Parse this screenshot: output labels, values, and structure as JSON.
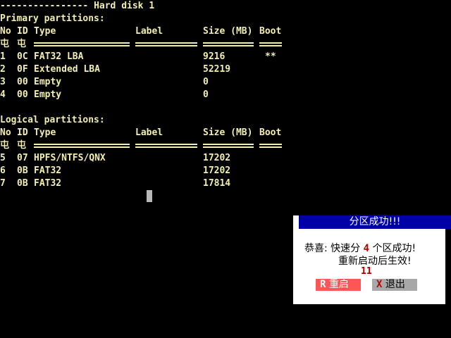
{
  "header": {
    "dashes": "----------------",
    "title": "Hard disk 1"
  },
  "columns": {
    "no": "No",
    "id": "ID",
    "type": "Type",
    "label": "Label",
    "size": "Size (MB)",
    "boot": "Boot"
  },
  "sep_glyph": "屯",
  "primary": {
    "heading": "Primary partitions:",
    "rows": [
      {
        "no": "1",
        "id": "0C",
        "type": "FAT32 LBA",
        "label": "",
        "size": "9216",
        "boot": "**"
      },
      {
        "no": "2",
        "id": "0F",
        "type": "Extended LBA",
        "label": "",
        "size": "52219",
        "boot": ""
      },
      {
        "no": "3",
        "id": "00",
        "type": "Empty",
        "label": "",
        "size": "0",
        "boot": ""
      },
      {
        "no": "4",
        "id": "00",
        "type": "Empty",
        "label": "",
        "size": "0",
        "boot": ""
      }
    ]
  },
  "logical": {
    "heading": "Logical partitions:",
    "rows": [
      {
        "no": "5",
        "id": "07",
        "type": "HPFS/NTFS/QNX",
        "label": "",
        "size": "17202",
        "boot": ""
      },
      {
        "no": "6",
        "id": "0B",
        "type": "FAT32",
        "label": "",
        "size": "17202",
        "boot": ""
      },
      {
        "no": "7",
        "id": "0B",
        "type": "FAT32",
        "label": "",
        "size": "17814",
        "boot": ""
      }
    ]
  },
  "dialog": {
    "title": "分区成功!!!",
    "line1_prefix": "恭喜: 快速分",
    "count": "4",
    "line1_suffix": "个区成功!",
    "line2": "重新启动后生效!",
    "countdown": "11",
    "reboot_key": "R",
    "reboot_label": "重启",
    "exit_key": "X",
    "exit_label": "退出"
  }
}
